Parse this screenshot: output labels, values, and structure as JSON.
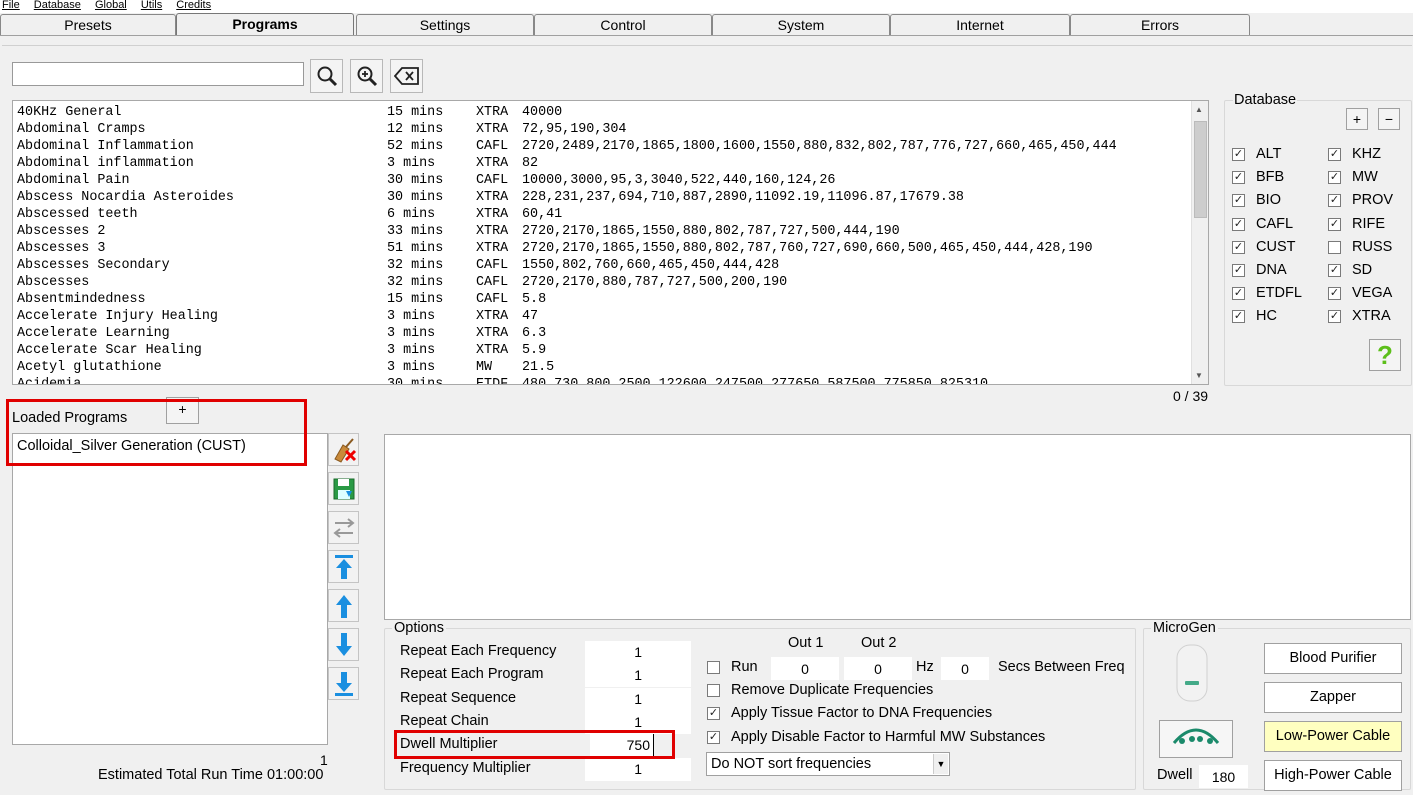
{
  "menu": [
    "File",
    "Database",
    "Global",
    "Utils",
    "Credits"
  ],
  "tabs": [
    "Presets",
    "Programs",
    "Settings",
    "Control",
    "System",
    "Internet",
    "Errors"
  ],
  "search": {
    "value": "",
    "placeholder": ""
  },
  "programs": [
    {
      "name": "40KHz General",
      "time": "15 mins",
      "db": "XTRA",
      "freqs": "40000"
    },
    {
      "name": "Abdominal Cramps",
      "time": "12 mins",
      "db": "XTRA",
      "freqs": "72,95,190,304"
    },
    {
      "name": "Abdominal Inflammation",
      "time": "52 mins",
      "db": "CAFL",
      "freqs": "2720,2489,2170,1865,1800,1600,1550,880,832,802,787,776,727,660,465,450,444"
    },
    {
      "name": "Abdominal inflammation",
      "time": "3 mins",
      "db": "XTRA",
      "freqs": "82"
    },
    {
      "name": "Abdominal Pain",
      "time": "30 mins",
      "db": "CAFL",
      "freqs": "10000,3000,95,3,3040,522,440,160,124,26"
    },
    {
      "name": "Abscess Nocardia Asteroides",
      "time": "30 mins",
      "db": "XTRA",
      "freqs": "228,231,237,694,710,887,2890,11092.19,11096.87,17679.38"
    },
    {
      "name": "Abscessed teeth",
      "time": "6 mins",
      "db": "XTRA",
      "freqs": "60,41"
    },
    {
      "name": "Abscesses 2",
      "time": "33 mins",
      "db": "XTRA",
      "freqs": "2720,2170,1865,1550,880,802,787,727,500,444,190"
    },
    {
      "name": "Abscesses 3",
      "time": "51 mins",
      "db": "XTRA",
      "freqs": "2720,2170,1865,1550,880,802,787,760,727,690,660,500,465,450,444,428,190"
    },
    {
      "name": "Abscesses Secondary",
      "time": "32 mins",
      "db": "CAFL",
      "freqs": "1550,802,760,660,465,450,444,428"
    },
    {
      "name": "Abscesses",
      "time": "32 mins",
      "db": "CAFL",
      "freqs": "2720,2170,880,787,727,500,200,190"
    },
    {
      "name": "Absentmindedness",
      "time": "15 mins",
      "db": "CAFL",
      "freqs": "5.8"
    },
    {
      "name": "Accelerate Injury Healing",
      "time": "3 mins",
      "db": "XTRA",
      "freqs": "47"
    },
    {
      "name": "Accelerate Learning",
      "time": "3 mins",
      "db": "XTRA",
      "freqs": "6.3"
    },
    {
      "name": "Accelerate Scar Healing",
      "time": "3 mins",
      "db": "XTRA",
      "freqs": "5.9"
    },
    {
      "name": "Acetyl glutathione",
      "time": "3 mins",
      "db": "MW",
      "freqs": "21.5"
    },
    {
      "name": "Acidemia",
      "time": "30 mins",
      "db": "ETDF",
      "freqs": "480,730,800,2500,122600,247500,277650,587500,775850,825310"
    }
  ],
  "list_counter": "0 / 39",
  "database": {
    "title": "Database",
    "items": [
      {
        "label": "ALT",
        "checked": true
      },
      {
        "label": "KHZ",
        "checked": true
      },
      {
        "label": "BFB",
        "checked": true
      },
      {
        "label": "MW",
        "checked": true
      },
      {
        "label": "BIO",
        "checked": true
      },
      {
        "label": "PROV",
        "checked": true
      },
      {
        "label": "CAFL",
        "checked": true
      },
      {
        "label": "RIFE",
        "checked": true
      },
      {
        "label": "CUST",
        "checked": true
      },
      {
        "label": "RUSS",
        "checked": false
      },
      {
        "label": "DNA",
        "checked": true
      },
      {
        "label": "SD",
        "checked": true
      },
      {
        "label": "ETDFL",
        "checked": true
      },
      {
        "label": "VEGA",
        "checked": true
      },
      {
        "label": "HC",
        "checked": true
      },
      {
        "label": "XTRA",
        "checked": true
      }
    ],
    "plus": "+",
    "minus": "−",
    "help": "?"
  },
  "loaded": {
    "title": "Loaded Programs",
    "add": "+",
    "items": [
      "Colloidal_Silver Generation (CUST)"
    ],
    "count": "1",
    "est_time": "Estimated Total Run Time 01:00:00"
  },
  "options": {
    "title": "Options",
    "rows": [
      {
        "label": "Repeat Each Frequency",
        "value": "1"
      },
      {
        "label": "Repeat Each Program",
        "value": "1"
      },
      {
        "label": "Repeat Sequence",
        "value": "1"
      },
      {
        "label": "Repeat Chain",
        "value": "1"
      },
      {
        "label": "Dwell Multiplier",
        "value": "750"
      },
      {
        "label": "Frequency Multiplier",
        "value": "1"
      }
    ],
    "out1": "Out 1",
    "out2": "Out 2",
    "run": "Run",
    "run_out1": "0",
    "run_out2": "0",
    "hz": "Hz",
    "secs_value": "0",
    "secs_label": "Secs Between Freq",
    "checks": [
      {
        "label": "Remove Duplicate Frequencies",
        "checked": false
      },
      {
        "label": "Apply Tissue Factor to DNA Frequencies",
        "checked": true
      },
      {
        "label": "Apply Disable Factor to Harmful MW Substances",
        "checked": true
      }
    ],
    "sort": "Do NOT sort frequencies"
  },
  "microgen": {
    "title": "MicroGen",
    "buttons": [
      "Blood Purifier",
      "Zapper",
      "Low-Power Cable",
      "High-Power Cable"
    ],
    "dwell_label": "Dwell",
    "dwell_value": "180"
  },
  "colors": {
    "highlight": "#ffffc0",
    "red_box": "#e00000",
    "accent_blue": "#1a8fe0"
  }
}
